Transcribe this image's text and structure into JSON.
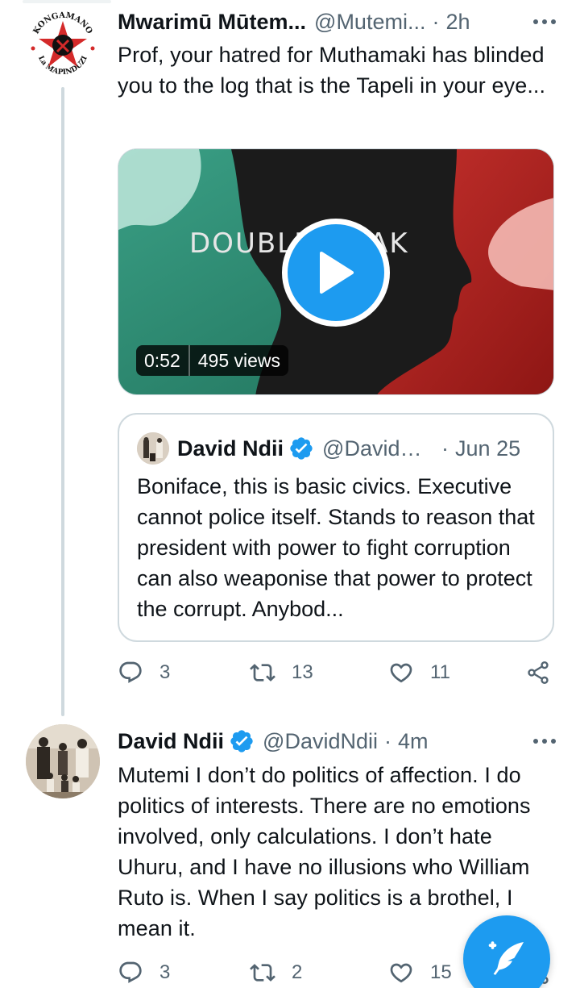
{
  "tweets": [
    {
      "author": "Mwarimū Mūtem...",
      "handle": "@Mutemi...",
      "separator": "·",
      "time": "2h",
      "text": "Prof, your hatred for Muthamaki has blinded you to the log that is the Tapeli in your eye...",
      "avatar_text_top": "KONGAMANO",
      "avatar_text_bottom": "La MAPINDUZI",
      "video": {
        "overlay_text": "DOUBLESPEAK",
        "duration": "0:52",
        "views": "495 views"
      },
      "quote": {
        "author": "David Ndii",
        "handle": "@DavidNdii",
        "separator": "·",
        "date": "Jun 25",
        "text": "Boniface, this is basic civics. Executive cannot police itself. Stands to reason that president with power to fight corruption can also weaponise that power to protect the corrupt. Anybod..."
      },
      "actions": {
        "replies": "3",
        "retweets": "13",
        "likes": "11"
      }
    },
    {
      "author": "David Ndii",
      "handle": "@DavidNdii",
      "separator": "·",
      "time": "4m",
      "text": "Mutemi I don’t do politics of affection. I do politics of interests. There are no emotions involved, only calculations. I don’t hate Uhuru, and I have no illusions who William Ruto is. When I say politics is a brothel, I mean it.",
      "actions": {
        "replies": "3",
        "retweets": "2",
        "likes": "15"
      }
    }
  ],
  "colors": {
    "accent": "#1d9bf0",
    "text_primary": "#0f1419",
    "text_secondary": "#536471",
    "border": "#cfd9de"
  },
  "icons": {
    "reply": "reply-icon",
    "retweet": "retweet-icon",
    "like": "heart-icon",
    "share": "share-icon",
    "verified": "verified-badge-icon",
    "more": "more-icon",
    "play": "play-icon",
    "compose": "compose-tweet-icon"
  }
}
